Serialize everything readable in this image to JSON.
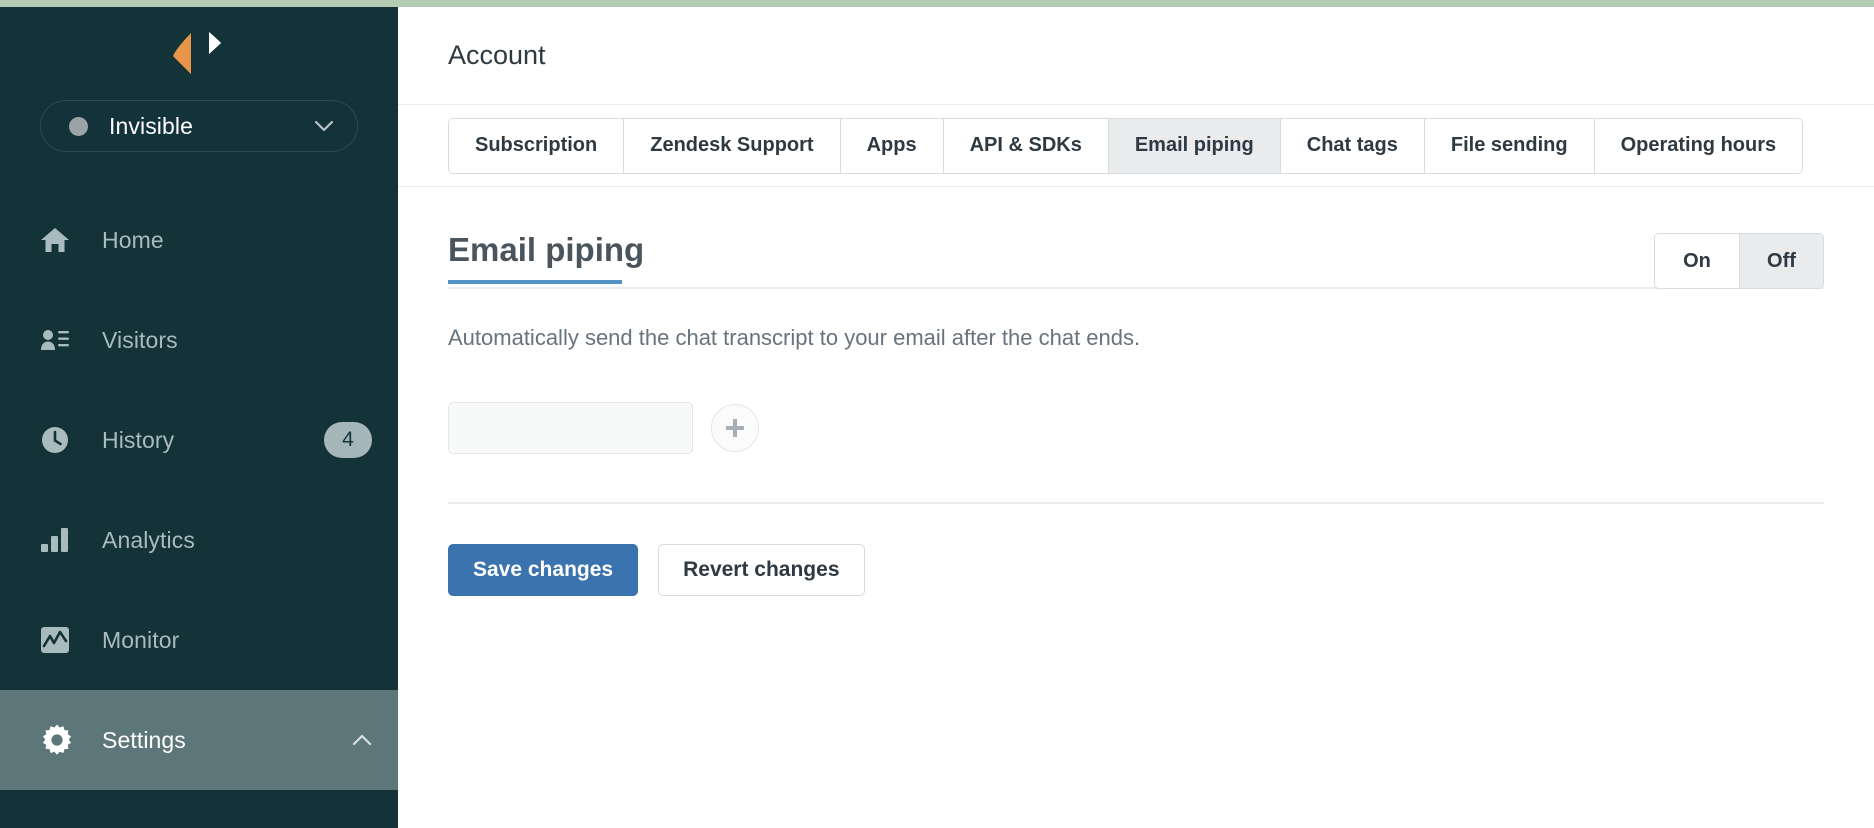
{
  "colors": {
    "sidebar_bg": "#143339",
    "sidebar_active": "#5c7679",
    "top_strip": "#b3ccb3",
    "accent_blue": "#5293c7",
    "primary_button": "#3a73ad",
    "logo_orange": "#e8954a",
    "logo_white": "#ffffff"
  },
  "sidebar": {
    "logo": {
      "left_icon": "logo-diamond-orange",
      "right_icon": "logo-diamond-white"
    },
    "status": {
      "label": "Invisible",
      "dot_color": "#9aa3a5",
      "chevron": "chevron-down-icon"
    },
    "items": [
      {
        "label": "Home",
        "icon": "home-icon",
        "badge": null,
        "active": false,
        "chevron": null
      },
      {
        "label": "Visitors",
        "icon": "visitors-icon",
        "badge": null,
        "active": false,
        "chevron": null
      },
      {
        "label": "History",
        "icon": "clock-icon",
        "badge": "4",
        "active": false,
        "chevron": null
      },
      {
        "label": "Analytics",
        "icon": "bar-chart-icon",
        "badge": null,
        "active": false,
        "chevron": null
      },
      {
        "label": "Monitor",
        "icon": "monitor-icon",
        "badge": null,
        "active": false,
        "chevron": null
      },
      {
        "label": "Settings",
        "icon": "gear-icon",
        "badge": null,
        "active": true,
        "chevron": "chevron-up-icon"
      }
    ]
  },
  "header": {
    "title": "Account"
  },
  "tabs": [
    {
      "label": "Subscription",
      "selected": false
    },
    {
      "label": "Zendesk Support",
      "selected": false
    },
    {
      "label": "Apps",
      "selected": false
    },
    {
      "label": "API & SDKs",
      "selected": false
    },
    {
      "label": "Email piping",
      "selected": true
    },
    {
      "label": "Chat tags",
      "selected": false
    },
    {
      "label": "File sending",
      "selected": false
    },
    {
      "label": "Operating hours",
      "selected": false
    }
  ],
  "section": {
    "title": "Email piping",
    "description": "Automatically send the chat transcript to your email after the chat ends.",
    "toggle": {
      "on_label": "On",
      "off_label": "Off",
      "selected": "Off"
    },
    "email_field": {
      "value": "",
      "placeholder": ""
    },
    "add_button_icon": "plus-icon"
  },
  "actions": {
    "save_label": "Save changes",
    "revert_label": "Revert changes"
  }
}
